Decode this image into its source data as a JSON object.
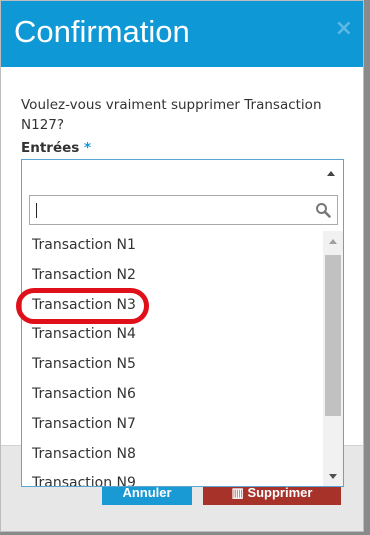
{
  "dialog": {
    "title": "Confirmation",
    "close_glyph": "×",
    "message": "Voulez-vous vraiment supprimer Transaction N127?",
    "field_label": "Entrées",
    "required_mark": "*",
    "search_value": "",
    "options": [
      "Transaction N1",
      "Transaction N2",
      "Transaction N3",
      "Transaction N4",
      "Transaction N5",
      "Transaction N6",
      "Transaction N7",
      "Transaction N8",
      "Transaction N9"
    ],
    "highlighted_option": "Transaction N3"
  },
  "footer": {
    "cancel_label": "Annuler",
    "delete_label": "Supprimer",
    "delete_icon": "trash-icon"
  },
  "colors": {
    "header": "#0e99d6",
    "cancel": "#1a9ad4",
    "delete": "#a6322a",
    "highlight": "#e0101a"
  }
}
